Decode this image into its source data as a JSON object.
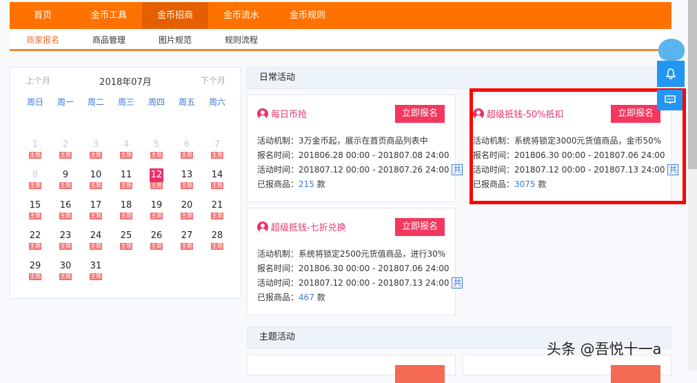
{
  "nav": [
    "首页",
    "金币工具",
    "金币招商",
    "金币流水",
    "金币规则"
  ],
  "subnav": [
    "商家报名",
    "商品管理",
    "图片规范",
    "规则流程"
  ],
  "calendar": {
    "prev": "上个月",
    "title": "2018年07月",
    "next": "下个月",
    "weekdays": [
      "周日",
      "周一",
      "周二",
      "周三",
      "周四",
      "周五",
      "周六"
    ],
    "tag": "主题",
    "today": "12",
    "days": [
      "1",
      "2",
      "3",
      "4",
      "5",
      "6",
      "7",
      "8",
      "9",
      "10",
      "11",
      "12",
      "13",
      "14",
      "15",
      "16",
      "17",
      "18",
      "19",
      "20",
      "21",
      "22",
      "23",
      "24",
      "25",
      "26",
      "27",
      "28",
      "29",
      "30",
      "31"
    ]
  },
  "daily": {
    "header": "日常活动",
    "cards": [
      {
        "title": "每日币抢",
        "button": "立即报名",
        "mechanism": "活动机制：3万金币起，展示在首页商品列表中",
        "signup": "报名时间：201806.28 00:00 - 201807.08 24:00",
        "active": "活动时间：201807.12 00:00 - 201807.26 24:00",
        "gong": "共",
        "registered_label": "已报商品：",
        "count": "215",
        "unit": "款"
      },
      {
        "title": "超级抵钱-50%抵扣",
        "button": "立即报名",
        "mechanism": "活动机制：系统将锁定3000元货值商品，金币50%",
        "signup": "报名时间：201806.30 00:00 - 201807.06 24:00",
        "active": "活动时间：201807.12 00:00 - 201807.13 24:00",
        "gong": "共",
        "registered_label": "已报商品：",
        "count": "3075",
        "unit": "款"
      },
      {
        "title": "超级抵钱-七折兑换",
        "button": "立即报名",
        "mechanism": "活动机制：系统将锁定2500元货值商品，进行30%",
        "signup": "报名时间：201806.30 00:00 - 201807.06 24:00",
        "active": "活动时间：201807.12 00:00 - 201807.13 24:00",
        "gong": "共",
        "registered_label": "已报商品：",
        "count": "467",
        "unit": "款"
      }
    ]
  },
  "theme": {
    "header": "主题活动"
  },
  "watermark": "头条 @吾悦十一a"
}
